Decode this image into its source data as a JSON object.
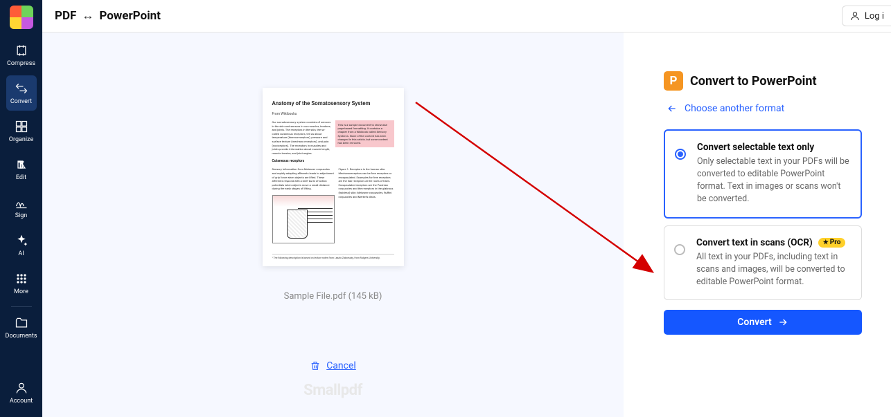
{
  "header": {
    "title_left": "PDF",
    "arrow": "↔",
    "title_right": "PowerPoint",
    "login": "Log i"
  },
  "sidebar": {
    "items": [
      {
        "label": "Compress"
      },
      {
        "label": "Convert"
      },
      {
        "label": "Organize"
      },
      {
        "label": "Edit"
      },
      {
        "label": "Sign"
      },
      {
        "label": "AI"
      },
      {
        "label": "More"
      },
      {
        "label": "Documents"
      },
      {
        "label": "Account"
      }
    ]
  },
  "main": {
    "preview_title": "Anatomy of the Somatosensory System",
    "filename": "Sample File.pdf (145 kB)",
    "cancel": "Cancel",
    "watermark": "Smallpdf"
  },
  "panel": {
    "heading": "Convert to PowerPoint",
    "choose_another": "Choose another format",
    "option1": {
      "title": "Convert selectable text only",
      "desc": "Only selectable text in your PDFs will be converted to editable PowerPoint format. Text in images or scans won't be converted."
    },
    "option2": {
      "title": "Convert text in scans (OCR)",
      "badge": "Pro",
      "desc": "All text in your PDFs, including text in scans and images, will be converted to editable PowerPoint format."
    },
    "convert_btn": "Convert"
  }
}
